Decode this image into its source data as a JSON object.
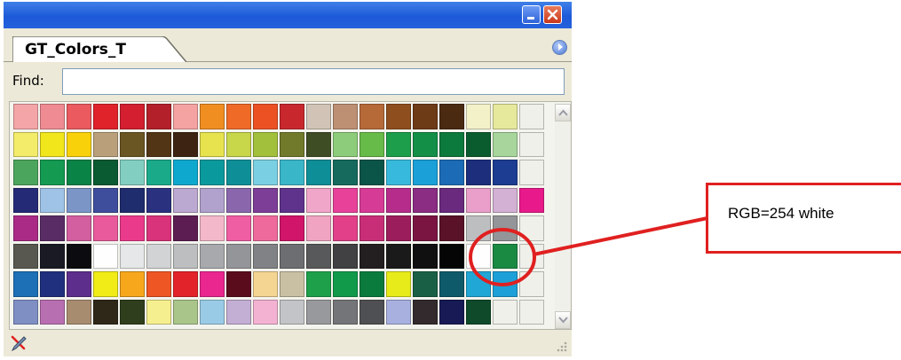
{
  "window": {
    "tab_title": "GT_Colors_T",
    "icons": {
      "minimize": "minimize-icon",
      "close": "close-icon",
      "panel_menu": "panel-menu-icon",
      "status": "eyedropper-icon",
      "grip": "resize-grip-icon"
    }
  },
  "find": {
    "label": "Find:",
    "value": ""
  },
  "swatches": [
    "#f4a5a8",
    "#ef8b92",
    "#ea5a5f",
    "#e0232b",
    "#d31f2f",
    "#b3202a",
    "#f4a2a2",
    "#f18e21",
    "#ef6a27",
    "#ec5124",
    "#c9272e",
    "#d1c4b6",
    "#bd8f73",
    "#b66a38",
    "#8f4e1e",
    "#6e3b17",
    "#4a2a11",
    "#f2f1c8",
    "#e6e89c",
    "#f0f0ea",
    "#f3ec6a",
    "#f1e51c",
    "#f8d10a",
    "#b9a07b",
    "#6a5622",
    "#523515",
    "#3c2312",
    "#e6e34f",
    "#c8d64a",
    "#a2c03c",
    "#707a2a",
    "#3f4d25",
    "#8ccc7a",
    "#67bb49",
    "#1c9e4b",
    "#138f47",
    "#0c7a3c",
    "#0a5c2e",
    "#a7d59c",
    "#f0f0ea",
    "#4ca55d",
    "#159a52",
    "#0a8347",
    "#0a5a32",
    "#82cfc2",
    "#1aaa8a",
    "#0ea8cf",
    "#0a9a9d",
    "#0e8f97",
    "#7ad0e2",
    "#3ab6c9",
    "#0e8e97",
    "#156a5d",
    "#0a5548",
    "#37b9dd",
    "#1ba0d8",
    "#1c6bb6",
    "#1d2e7d",
    "#1d3d92",
    "#f0f0ea",
    "#252a77",
    "#9fc3e6",
    "#7b95c7",
    "#3f4d9d",
    "#1f2c6e",
    "#2a3280",
    "#bca9d2",
    "#b0a1cd",
    "#8a66ad",
    "#7c3e97",
    "#5f338c",
    "#f0a6c9",
    "#e8419a",
    "#d63c96",
    "#b52c8b",
    "#8a2d83",
    "#6a2a7e",
    "#e99fc9",
    "#d3b1d4",
    "#e8198b",
    "#aa2b86",
    "#5a2c66",
    "#d35ea0",
    "#e85a9c",
    "#ea3a8b",
    "#d8337b",
    "#5c1e52",
    "#f4b8cb",
    "#ef5da2",
    "#ee6a9c",
    "#d0156a",
    "#f0a4c2",
    "#e24089",
    "#c82e77",
    "#9c1d5c",
    "#7a1542",
    "#591228",
    "#bcbec0",
    "#939598",
    "#f0f0ea",
    "#585850",
    "#1a1a24",
    "#0c0c10",
    "#fefefe",
    "#e6e7e8",
    "#d1d3d4",
    "#bcbec0",
    "#a7a9ac",
    "#939598",
    "#808285",
    "#6d6e71",
    "#58595b",
    "#414042",
    "#231f20",
    "#1a1a1a",
    "#101010",
    "#050505",
    "#fefefe",
    "#1a8a43",
    "#f0f0ea",
    "#1d6fb6",
    "#20307f",
    "#5d2e8b",
    "#f1ec17",
    "#f6a71c",
    "#ee5623",
    "#e3232a",
    "#ea268f",
    "#5a0c1d",
    "#f5d592",
    "#c9c0a3",
    "#1ea04b",
    "#119a4a",
    "#0a7b3d",
    "#e7eb1a",
    "#195f46",
    "#0e5a6a",
    "#20a7d5",
    "#1da0d7",
    "#f0f0ea",
    "#7f8fc4",
    "#b86fb1",
    "#a88c70",
    "#2f2818",
    "#2f3e1c",
    "#f5ef8f",
    "#a9c58a",
    "#9acbe6",
    "#c3aed4",
    "#f4b2d3",
    "#c2c4c7",
    "#98999c",
    "#747578",
    "#4f5053",
    "#a7b0de",
    "#322a2c",
    "#171a55",
    "#0f4a2a",
    "#f0f0ea",
    "#f0f0ea"
  ],
  "callout": {
    "text": "RGB=254 white",
    "color": "#e02020"
  }
}
